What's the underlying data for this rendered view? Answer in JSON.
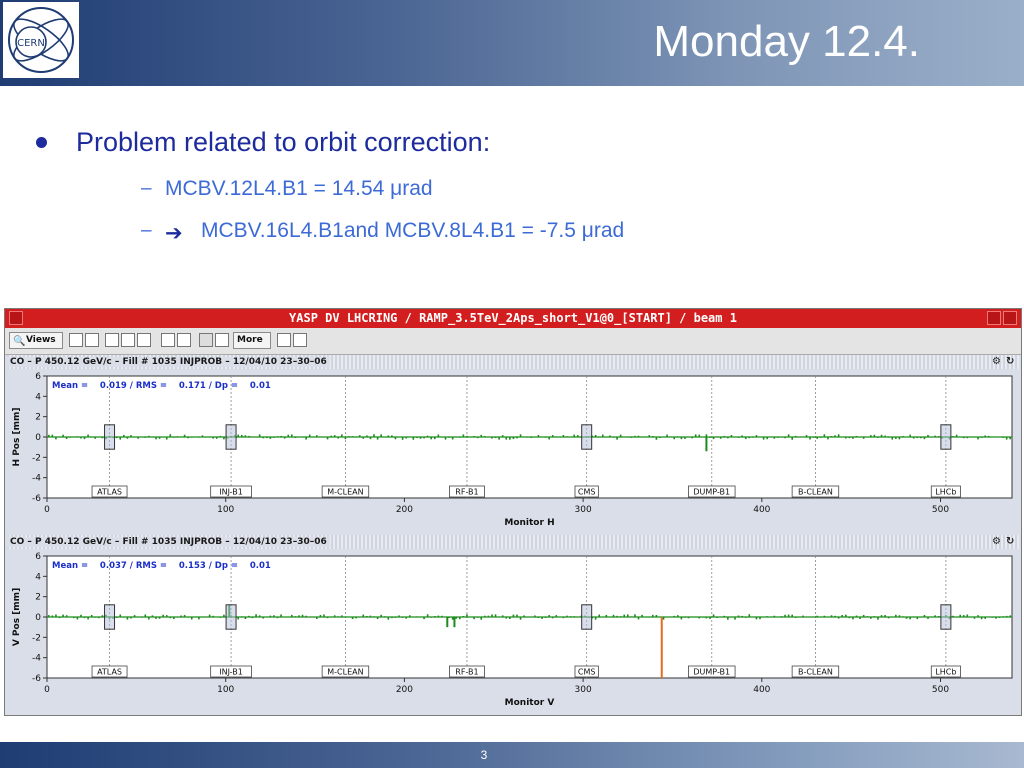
{
  "slide": {
    "logo_text": "CERN",
    "title": "Monday 12.4.",
    "bullet": "Problem related to orbit correction:",
    "sub_items": [
      {
        "dash": "–",
        "text": "MCBV.12L4.B1 = 14.54 μrad"
      },
      {
        "dash": "–",
        "text": "MCBV.16L4.B1and MCBV.8L4.B1 = -7.5 μrad"
      }
    ],
    "page_number": "3"
  },
  "app": {
    "title": "YASP DV LHCRING / RAMP_3.5TeV_2Aps_short_V1@0_[START] / beam 1",
    "toolbar": {
      "views_label": "Views",
      "more_label": "More"
    },
    "panels": [
      {
        "header": "CO – P 450.12 GeV/c – Fill # 1035 INJPROB – 12/04/10 23–30–06",
        "stats": "Mean =    0.019 / RMS =    0.171 / Dp =    0.01",
        "ylabel": "H Pos [mm]",
        "xlabel": "Monitor H"
      },
      {
        "header": "CO – P 450.12 GeV/c – Fill # 1035 INJPROB – 12/04/10 23–30–06",
        "stats": "Mean =    0.037 / RMS =    0.153 / Dp =    0.01",
        "ylabel": "V Pos [mm]",
        "xlabel": "Monitor V"
      }
    ]
  },
  "chart_data": [
    {
      "type": "bar",
      "ylabel": "H Pos [mm]",
      "xlabel": "Monitor H",
      "xlim": [
        0,
        540
      ],
      "ylim": [
        -6,
        6
      ],
      "x_ticks": [
        "0",
        "100",
        "200",
        "300",
        "400",
        "500"
      ],
      "y_ticks": [
        "6",
        "4",
        "2",
        "0",
        "-2",
        "-4",
        "-6"
      ],
      "markers": [
        {
          "label": "ATLAS",
          "x": 35
        },
        {
          "label": "INJ-B1",
          "x": 103
        },
        {
          "label": "M-CLEAN",
          "x": 167
        },
        {
          "label": "RF-B1",
          "x": 235
        },
        {
          "label": "CMS",
          "x": 302
        },
        {
          "label": "DUMP-B1",
          "x": 372
        },
        {
          "label": "B-CLEAN",
          "x": 430
        },
        {
          "label": "LHCb",
          "x": 503
        }
      ],
      "ip_boxes": [
        35,
        103,
        302,
        503
      ],
      "series_color": "#1a8c1a",
      "highlight": [
        {
          "x": 369,
          "value": -1.4,
          "color": "#1a8c1a"
        }
      ]
    },
    {
      "type": "bar",
      "ylabel": "V Pos [mm]",
      "xlabel": "Monitor V",
      "xlim": [
        0,
        540
      ],
      "ylim": [
        -6,
        6
      ],
      "x_ticks": [
        "0",
        "100",
        "200",
        "300",
        "400",
        "500"
      ],
      "y_ticks": [
        "6",
        "4",
        "2",
        "0",
        "-2",
        "-4",
        "-6"
      ],
      "markers": [
        {
          "label": "ATLAS",
          "x": 35
        },
        {
          "label": "INJ-B1",
          "x": 103
        },
        {
          "label": "M-CLEAN",
          "x": 167
        },
        {
          "label": "RF-B1",
          "x": 235
        },
        {
          "label": "CMS",
          "x": 302
        },
        {
          "label": "DUMP-B1",
          "x": 372
        },
        {
          "label": "B-CLEAN",
          "x": 430
        },
        {
          "label": "LHCb",
          "x": 503
        }
      ],
      "ip_boxes": [
        35,
        103,
        302,
        503
      ],
      "series_color": "#1a8c1a",
      "highlight": [
        {
          "x": 224,
          "value": -1.0,
          "color": "#1a8c1a"
        },
        {
          "x": 228,
          "value": -1.0,
          "color": "#1a8c1a"
        },
        {
          "x": 344,
          "value": -6.0,
          "color": "#e86a1c"
        },
        {
          "x": 102,
          "value": 1.2,
          "color": "#1a8c1a"
        }
      ]
    }
  ]
}
